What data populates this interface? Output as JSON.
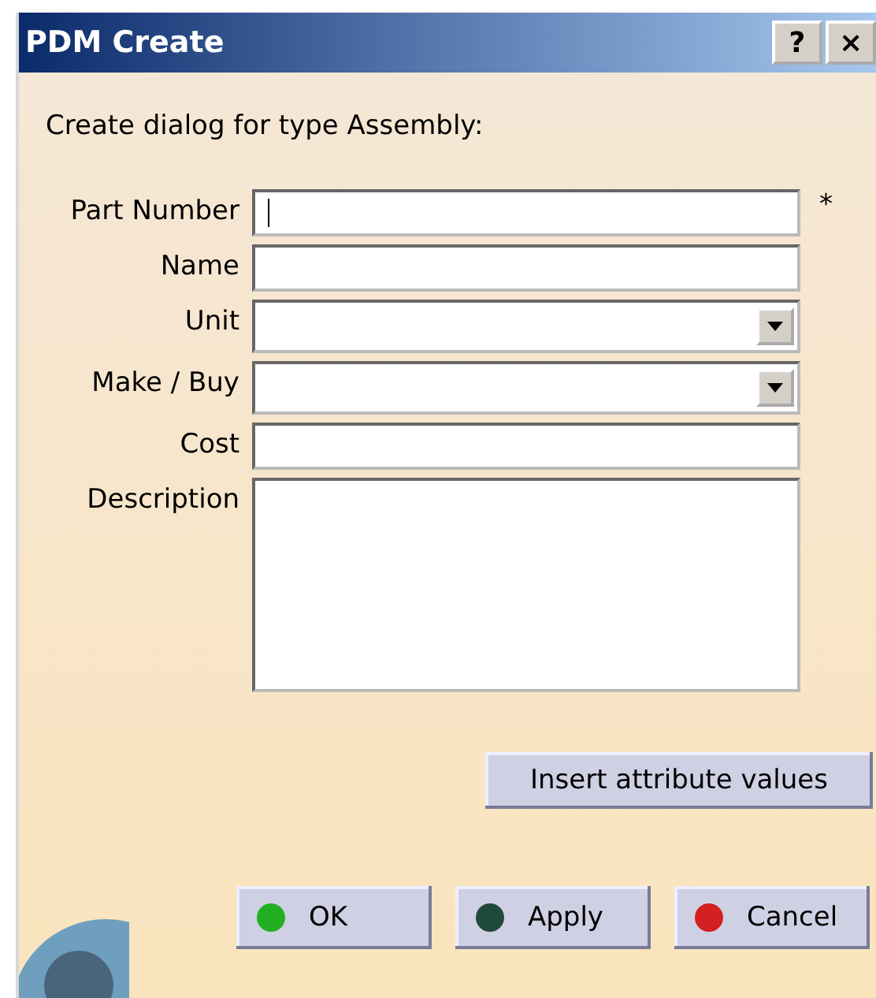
{
  "window": {
    "title": "PDM Create",
    "title_buttons": [
      "?",
      "×"
    ]
  },
  "intro": "Create dialog for type Assembly:",
  "fields": [
    {
      "label": "Part Number",
      "kind": "text",
      "focused": true,
      "required_mark": "*"
    },
    {
      "label": "Name",
      "kind": "text",
      "focused": false
    },
    {
      "label": "Unit",
      "kind": "combo",
      "focused": false
    },
    {
      "label": "Make / Buy",
      "kind": "combo",
      "focused": false
    },
    {
      "label": "Cost",
      "kind": "text",
      "focused": false
    },
    {
      "label": "Description",
      "kind": "textarea",
      "focused": false
    }
  ],
  "insert_button": "Insert attribute values",
  "buttons": [
    {
      "label": "OK",
      "color": "#22b022"
    },
    {
      "label": "Apply",
      "color": "#1f4a3a"
    },
    {
      "label": "Cancel",
      "color": "#d42020"
    }
  ]
}
